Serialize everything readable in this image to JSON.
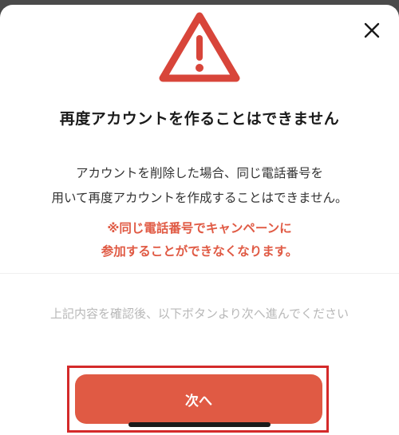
{
  "modal": {
    "close_icon": "close-icon",
    "warning_icon": "warning-triangle-icon",
    "title": "再度アカウントを作ることはできません",
    "description_lines": [
      "アカウントを削除した場合、同じ電話番号を",
      "用いて再度アカウントを作成することはできません。"
    ],
    "notice_lines": [
      "※同じ電話番号でキャンペーンに",
      "参加することができなくなります。"
    ],
    "instruction": "上記内容を確認後、以下ボタンより次へ進んでください",
    "next_button_label": "次へ"
  },
  "colors": {
    "accent": "#e05a44",
    "highlight_frame": "#d42a2a",
    "title_text": "#1a1a1a",
    "muted_text": "#b8b8b8"
  }
}
